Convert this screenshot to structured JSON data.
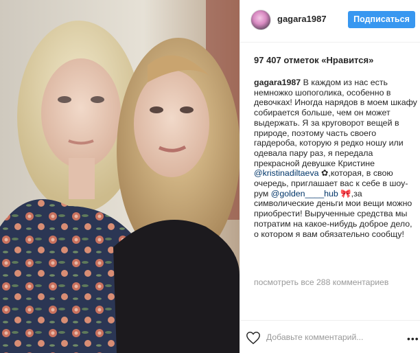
{
  "post": {
    "username": "gagara1987",
    "follow_label": "Подписаться",
    "likes_text": "97 407 отметок «Нравится»",
    "caption": {
      "username": "gagara1987",
      "part1": "В каждом из нас есть немножко шопоголика, особенно в девочках! Иногда нарядов в моем шкафу собирается больше, чем он может выдержать. Я за круговорот вещей в природе, поэтому часть своего гардероба, которую я редко ношу или одевала пару раз, я передала прекрасной девушке Кристине ",
      "mention1": "@kristinadiltaeva",
      "part2": " ✿,которая, в свою очередь, приглашает вас к себе в шоу-рум ",
      "mention2": "@golden____hub",
      "part3": " 🎀,за символические деньги мои вещи можно приобрести! Вырученные средства мы потратим на какое-нибудь доброе дело, о котором я вам обязательно сообщу!"
    },
    "view_all_comments": "посмотреть все 288 комментариев",
    "add_comment_placeholder": "Добавьте комментарий...",
    "more_options": "•••"
  },
  "icons": {
    "avatar": "profile-avatar",
    "heart": "heart-outline-icon",
    "more": "more-options-icon"
  },
  "colors": {
    "follow_button": "#3897f0",
    "link": "#003569",
    "muted": "#999999"
  }
}
